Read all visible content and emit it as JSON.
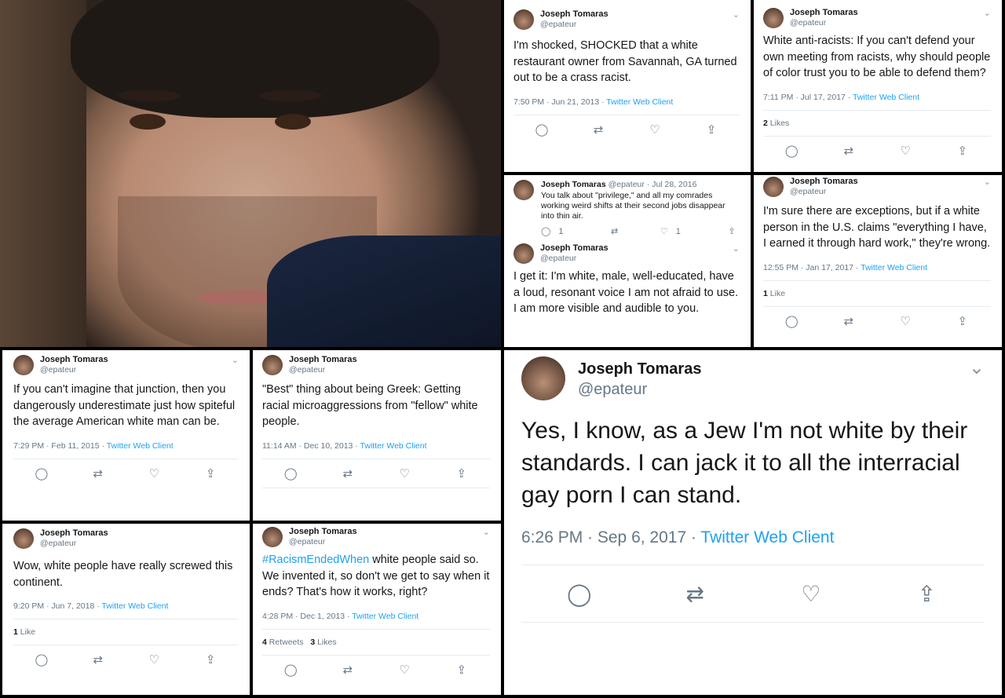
{
  "user": {
    "name": "Joseph Tomaras",
    "handle": "@epateur"
  },
  "client": "Twitter Web Client",
  "icons": [
    "reply-icon",
    "retweet-icon",
    "like-icon",
    "share-icon",
    "chevron-down-icon"
  ],
  "tweets": [
    {
      "text": "I'm shocked, SHOCKED that a white restaurant owner from Savannah, GA turned out to be a crass racist.",
      "time": "7:50 PM · Jun 21, 2013 · "
    },
    {
      "text": "White anti-racists: If you can't defend your own meeting from racists, why should people of color trust you to be able to defend them?",
      "time": "7:11 PM · Jul 17, 2017 · ",
      "likes_num": "2",
      "likes_label": "Likes"
    },
    {
      "handle_date": "@epateur · Jul 28, 2016",
      "text": "You talk about \"privilege,\" and all my comrades working weird shifts at their second jobs disappear into thin air.",
      "replies": "1",
      "likes": "1"
    },
    {
      "text": "I get it: I'm white, male, well-educated, have a loud, resonant voice I am not afraid to use. I am more visible and audible to you."
    },
    {
      "text": "I'm sure there are exceptions, but if a white person in the U.S. claims \"everything I have, I earned it through hard work,\" they're wrong.",
      "time": "12:55 PM · Jan 17, 2017 · ",
      "likes_num": "1",
      "likes_label": "Like"
    },
    {
      "text": "If you can't imagine that junction, then you dangerously underestimate just how spiteful the average American white man can be.",
      "time": "7:29 PM · Feb 11, 2015 · "
    },
    {
      "text": "\"Best\" thing about being Greek: Getting racial microaggressions from \"fellow\" white people.",
      "time": "11:14 AM · Dec 10, 2013 · "
    },
    {
      "text": "Yes, I know, as a Jew I'm not white by their standards. I can jack it to all the interracial gay porn I can stand.",
      "time": "6:26 PM · Sep 6, 2017 · "
    },
    {
      "text": "Wow, white people have really screwed this continent.",
      "time": "9:20 PM · Jun 7, 2018 · ",
      "likes_num": "1",
      "likes_label": "Like"
    },
    {
      "hashtag": "#RacismEndedWhen",
      "text": " white people said so. We invented it, so don't we get to say when it ends? That's how it works, right?",
      "time": "4:28 PM · Dec 1, 2013 · ",
      "retweets_num": "4",
      "retweets_label": "Retweets",
      "likes_num": "3",
      "likes_label": "Likes"
    }
  ]
}
